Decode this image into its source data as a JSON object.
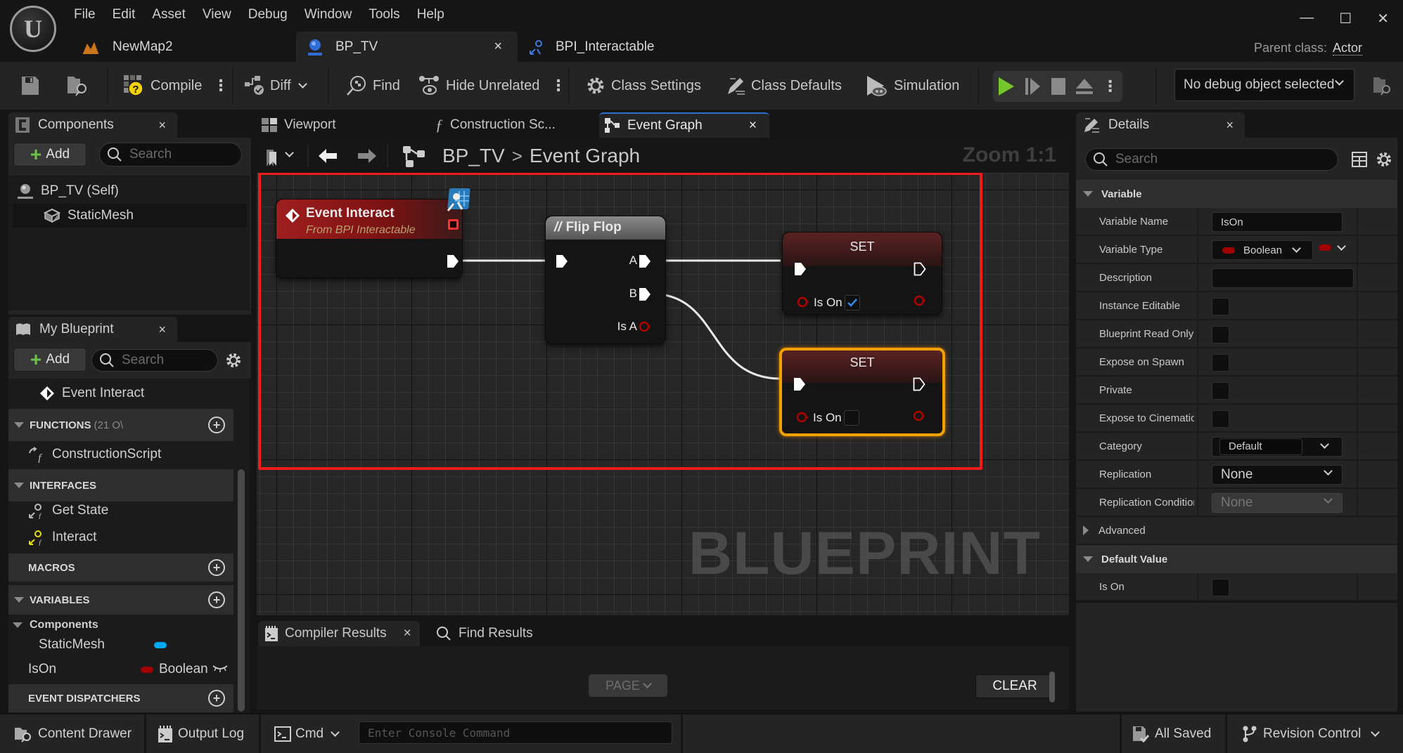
{
  "menu": [
    "File",
    "Edit",
    "Asset",
    "View",
    "Debug",
    "Window",
    "Tools",
    "Help"
  ],
  "window_controls": {
    "minimize": "—",
    "maximize": "☐",
    "close": "✕"
  },
  "doc_tabs": [
    {
      "label": "NewMap2",
      "icon": "level-icon"
    },
    {
      "label": "BP_TV",
      "icon": "blueprint-actor-icon",
      "active": true,
      "close": "×"
    },
    {
      "label": "BPI_Interactable",
      "icon": "blueprint-interface-icon"
    }
  ],
  "parent_class": {
    "label": "Parent class:",
    "value": "Actor"
  },
  "toolbar": {
    "compile": "Compile",
    "diff": "Diff",
    "find": "Find",
    "hide_unrelated": "Hide Unrelated",
    "class_settings": "Class Settings",
    "class_defaults": "Class Defaults",
    "simulation": "Simulation",
    "debug_object": "No debug object selected",
    "play_accent": "#74c62a"
  },
  "components_panel": {
    "title": "Components",
    "close": "×",
    "add_label": "Add",
    "search_placeholder": "Search",
    "items": [
      {
        "label": "BP_TV (Self)",
        "icon": "actor-icon"
      },
      {
        "label": "StaticMesh",
        "icon": "static-mesh-icon"
      }
    ]
  },
  "my_blueprint": {
    "title": "My Blueprint",
    "close": "×",
    "add_label": "Add",
    "search_placeholder": "Search",
    "event_item": "Event Interact",
    "sections": {
      "functions": {
        "label": "FUNCTIONS",
        "count": "(21 O\\",
        "items": [
          "ConstructionScript"
        ]
      },
      "interfaces": {
        "label": "INTERFACES",
        "items": [
          "Get State",
          "Interact"
        ]
      },
      "macros": {
        "label": "MACROS"
      },
      "variables": {
        "label": "VARIABLES",
        "group": "Components",
        "items": [
          {
            "name": "StaticMesh",
            "type": "",
            "color": "#00a8f3"
          },
          {
            "name": "IsOn",
            "type": "Boolean",
            "color": "#a00000"
          }
        ]
      },
      "event_dispatchers": {
        "label": "EVENT DISPATCHERS"
      }
    }
  },
  "graph": {
    "tabs": [
      {
        "label": "Viewport",
        "icon": "viewport-icon"
      },
      {
        "label": "Construction Sc...",
        "icon": "function-icon"
      },
      {
        "label": "Event Graph",
        "icon": "event-graph-icon",
        "active": true,
        "close": "×"
      }
    ],
    "breadcrumb": {
      "root": "BP_TV",
      "separator": ">",
      "current": "Event Graph"
    },
    "zoom": "Zoom 1:1",
    "watermark": "BLUEPRINT",
    "highlight_color": "#f01c1c",
    "nodes": {
      "event_interact": {
        "title": "Event Interact",
        "subtitle": "From BPI Interactable"
      },
      "flip_flop": {
        "title": "Flip Flop",
        "pins": {
          "a": "A",
          "b": "B",
          "is_a": "Is A"
        }
      },
      "set_1": {
        "title": "SET",
        "pin": "Is On",
        "checked": true
      },
      "set_2": {
        "title": "SET",
        "pin": "Is On",
        "checked": false,
        "selected": true
      }
    }
  },
  "compiler": {
    "tabs": [
      {
        "label": "Compiler Results",
        "close": "×",
        "active": true
      },
      {
        "label": "Find Results"
      }
    ],
    "page_label": "PAGE",
    "clear_label": "CLEAR"
  },
  "statusbar": {
    "content_drawer": "Content Drawer",
    "output_log": "Output Log",
    "cmd": "Cmd",
    "console_placeholder": "Enter Console Command",
    "all_saved": "All Saved",
    "revision_control": "Revision Control"
  },
  "details": {
    "title": "Details",
    "close": "×",
    "search_placeholder": "Search",
    "variable_section": "Variable",
    "rows": {
      "variable_name": {
        "label": "Variable Name",
        "value": "IsOn"
      },
      "variable_type": {
        "label": "Variable Type",
        "value": "Boolean"
      },
      "description": {
        "label": "Description",
        "value": ""
      },
      "instance_editable": {
        "label": "Instance Editable",
        "checked": false
      },
      "blueprint_read_only": {
        "label": "Blueprint Read Only",
        "checked": false
      },
      "expose_on_spawn": {
        "label": "Expose on Spawn",
        "checked": false
      },
      "private": {
        "label": "Private",
        "checked": false
      },
      "expose_to_cinematics": {
        "label": "Expose to Cinematics",
        "checked": false
      },
      "category": {
        "label": "Category",
        "value": "Default"
      },
      "replication": {
        "label": "Replication",
        "value": "None"
      },
      "replication_condition": {
        "label": "Replication Condition",
        "value": "None"
      }
    },
    "advanced": "Advanced",
    "default_value_section": "Default Value",
    "default_is_on": {
      "label": "Is On",
      "checked": false
    }
  }
}
